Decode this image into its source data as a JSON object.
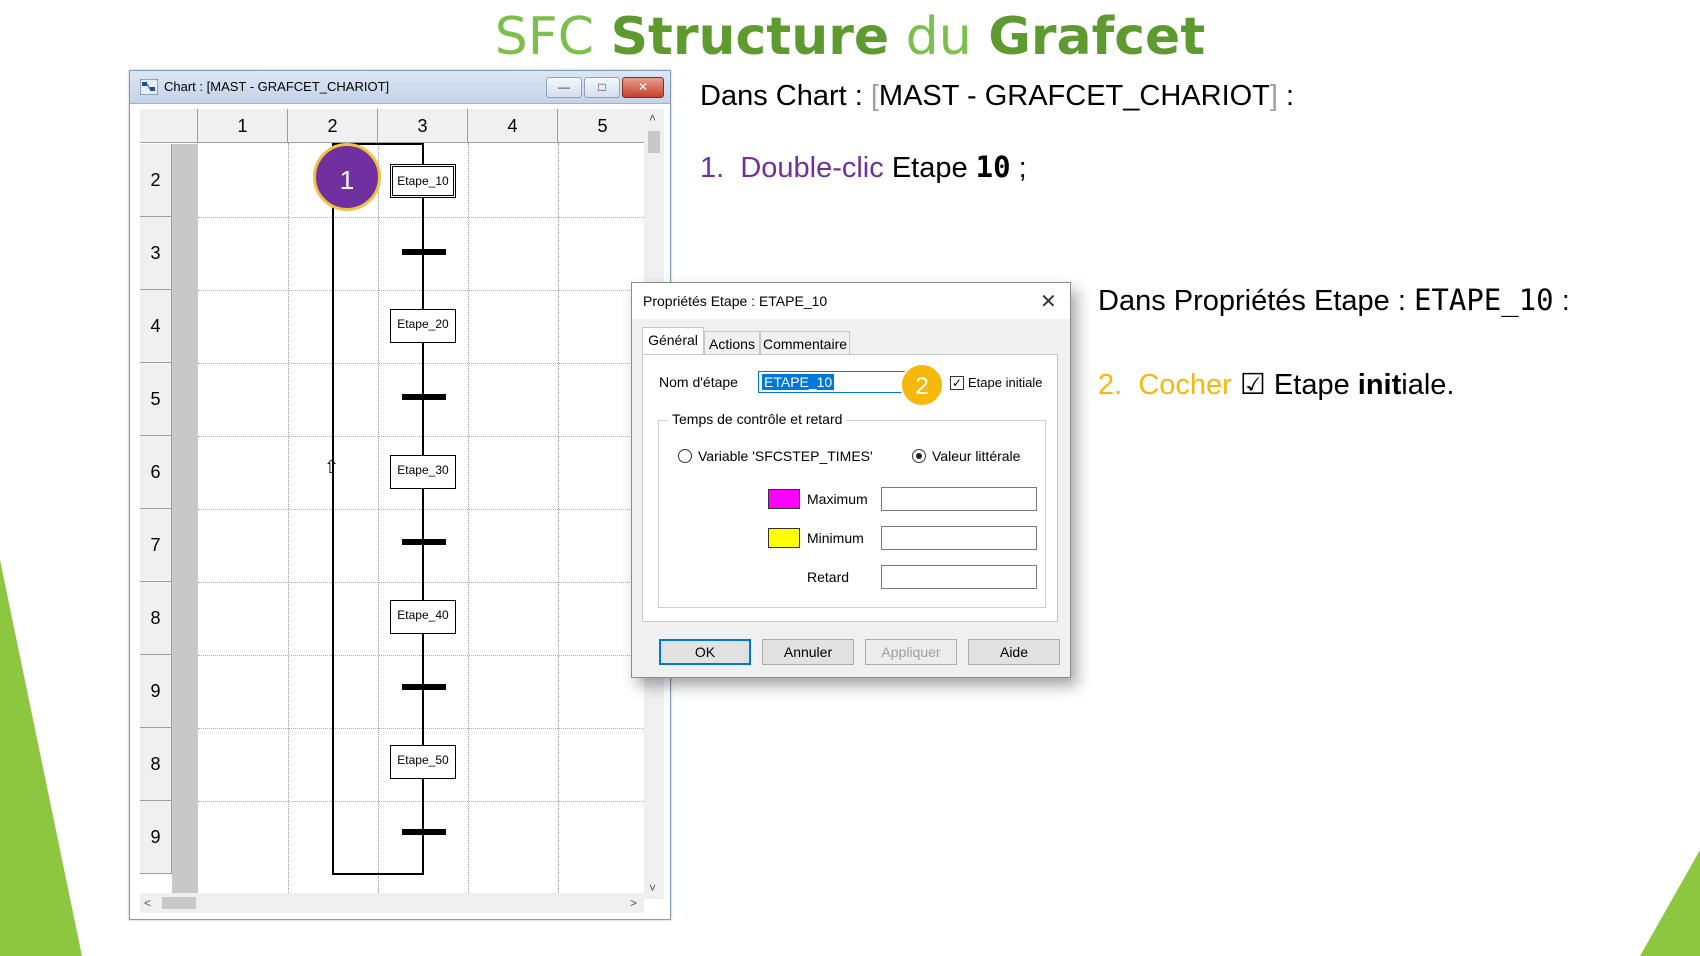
{
  "slide": {
    "title_part1": "SFC ",
    "title_part2": "Structure",
    "title_part3": " du ",
    "title_part4": "Grafcet"
  },
  "chart_window": {
    "title": "Chart : [MAST - GRAFCET_CHARIOT]",
    "min_label": "—",
    "max_label": "□",
    "close_label": "✕",
    "columns": [
      "1",
      "2",
      "3",
      "4",
      "5"
    ],
    "rows": [
      "2",
      "3",
      "4",
      "5",
      "6",
      "7",
      "8",
      "9",
      "8",
      "9"
    ],
    "steps": [
      "Etape_10",
      "Etape_20",
      "Etape_30",
      "Etape_40",
      "Etape_50"
    ],
    "scroll_up": "˄",
    "scroll_down": "˅",
    "scroll_left": "<",
    "scroll_right": ">",
    "link_arrow": "⇧"
  },
  "badges": {
    "one": "1",
    "two": "2"
  },
  "dialog": {
    "title": "Propriétés Etape : ETAPE_10",
    "close": "✕",
    "tabs": [
      "Général",
      "Actions",
      "Commentaire"
    ],
    "step_name_label": "Nom d'étape",
    "step_name_value": "ETAPE_10",
    "initial_check_mark": "✓",
    "initial_label": "Etape initiale",
    "group_title": "Temps de contrôle et retard",
    "radio_variable": "Variable 'SFCSTEP_TIMES'",
    "radio_literal": "Valeur littérale",
    "max_label": "Maximum",
    "min_label": "Minimum",
    "delay_label": "Retard",
    "max_color": "#ff00ff",
    "min_color": "#ffff00",
    "buttons": {
      "ok": "OK",
      "cancel": "Annuler",
      "apply": "Appliquer",
      "help": "Aide"
    }
  },
  "instructions": {
    "line1_prefix": "Dans Chart : ",
    "line1_bracket_open": "[",
    "line1_value": "MAST - GRAFCET_CHARIOT",
    "line1_bracket_close": "]",
    "line1_suffix": " :",
    "step1_num": "1.",
    "step1_action": "Double-clic",
    "step1_text": " Etape ",
    "step1_value": "10",
    "step1_suffix": " ;",
    "line2_prefix": "Dans Propriétés Etape : ",
    "line2_value": "ETAPE_10",
    "line2_suffix": " :",
    "step2_num": "2.",
    "step2_action": "Cocher",
    "step2_check": " ☑ Etape ",
    "step2_bold": "init",
    "step2_suffix": "iale."
  },
  "colors": {
    "accent_green": "#6aa83f",
    "purple": "#7030a0",
    "orange": "#f5b80c"
  }
}
